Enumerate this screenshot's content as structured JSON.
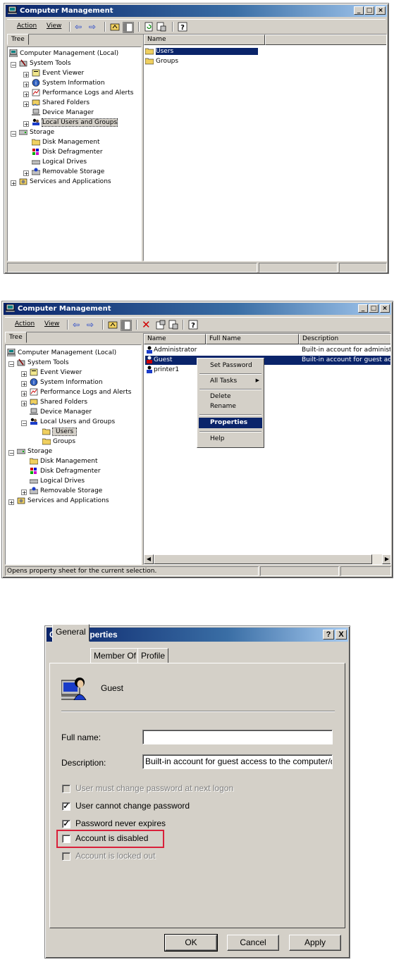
{
  "window1": {
    "title": "Computer Management",
    "menu": [
      "Action",
      "View"
    ],
    "tab": "Tree",
    "tree": [
      "Computer Management (Local)",
      "System Tools",
      "Event Viewer",
      "System Information",
      "Performance Logs and Alerts",
      "Shared Folders",
      "Device Manager",
      "Local Users and Groups",
      "Storage",
      "Disk Management",
      "Disk Defragmenter",
      "Logical Drives",
      "Removable Storage",
      "Services and Applications"
    ],
    "list_header": "Name",
    "list_items": [
      "Users",
      "Groups"
    ]
  },
  "window2": {
    "title": "Computer Management",
    "menu": [
      "Action",
      "View"
    ],
    "tab": "Tree",
    "tree": [
      "Computer Management (Local)",
      "System Tools",
      "Event Viewer",
      "System Information",
      "Performance Logs and Alerts",
      "Shared Folders",
      "Device Manager",
      "Local Users and Groups",
      "Users",
      "Groups",
      "Storage",
      "Disk Management",
      "Disk Defragmenter",
      "Logical Drives",
      "Removable Storage",
      "Services and Applications"
    ],
    "columns": [
      "Name",
      "Full Name",
      "Description"
    ],
    "rows": [
      {
        "name": "Administrator",
        "fullname": "",
        "desc": "Built-in account for administerin"
      },
      {
        "name": "Guest",
        "fullname": "",
        "desc": "Built-in account for guest acce"
      },
      {
        "name": "printer1",
        "fullname": "",
        "desc": ""
      }
    ],
    "context_menu": [
      "Set Password",
      "All Tasks",
      "Delete",
      "Rename",
      "Properties",
      "Help"
    ],
    "status": "Opens property sheet for the current selection."
  },
  "dialog": {
    "title": "Guest Properties",
    "title_buttons": [
      "?",
      "X"
    ],
    "tabs": [
      "General",
      "Member Of",
      "Profile"
    ],
    "username": "Guest",
    "fullname_label": "Full name:",
    "fullname_value": "",
    "description_label": "Description:",
    "description_value": "Built-in account for guest access to the computer/dc",
    "options": [
      {
        "label": "User must change password at next logon",
        "checked": false,
        "enabled": false
      },
      {
        "label": "User cannot change password",
        "checked": true,
        "enabled": true
      },
      {
        "label": "Password never expires",
        "checked": true,
        "enabled": true
      },
      {
        "label": "Account is disabled",
        "checked": false,
        "enabled": true
      },
      {
        "label": "Account is locked out",
        "checked": false,
        "enabled": false
      }
    ],
    "buttons": [
      "OK",
      "Cancel",
      "Apply"
    ],
    "highlight_color": "#d9203a"
  }
}
